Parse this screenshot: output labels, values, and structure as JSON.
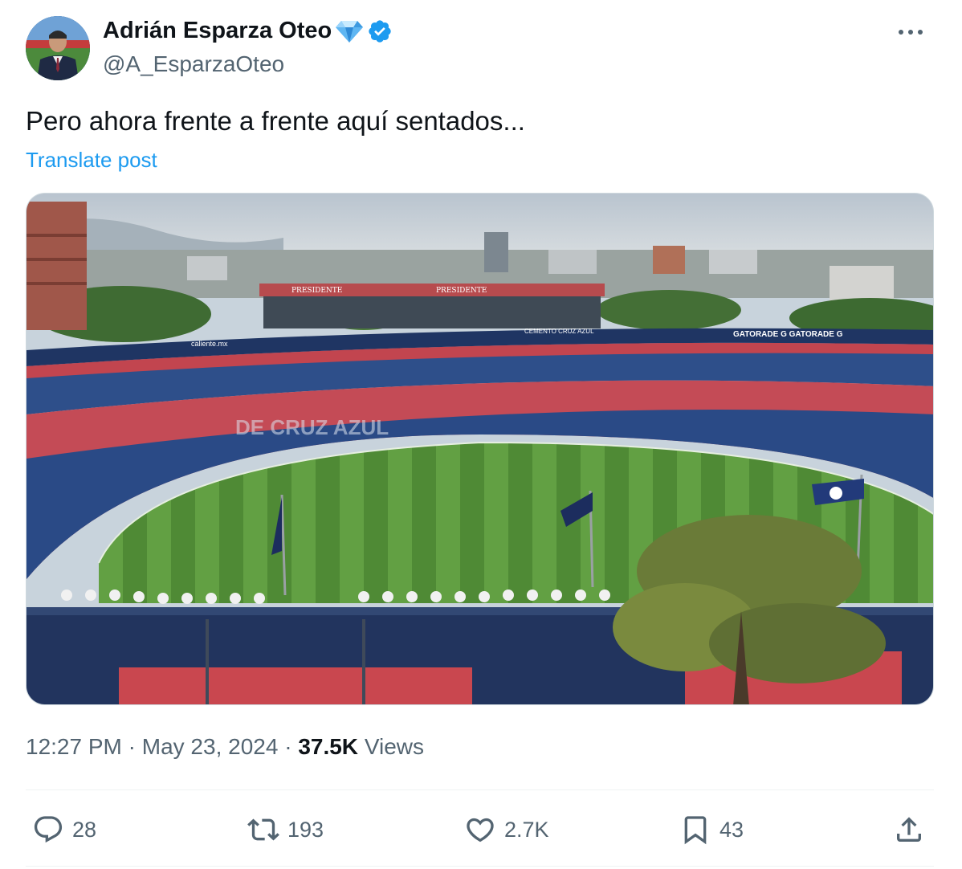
{
  "author": {
    "name": "Adrián Esparza Oteo",
    "handle": "@A_EsparzaOteo",
    "badges": [
      "diamond-emoji",
      "verified-badge"
    ],
    "verified_color": "#1d9bf0"
  },
  "tweet": {
    "text": "Pero ahora frente a frente aquí sentados...",
    "translate_label": "Translate post",
    "time": "12:27 PM",
    "separator": " · ",
    "date": "May 23, 2024",
    "views_count": "37.5K",
    "views_label": "Views"
  },
  "media": {
    "description_icon": "stadium-photo",
    "signage": {
      "gatorade": "GATORADE G GATORADE G",
      "caliente": "caliente.mx",
      "presidente": "PRESIDENTE",
      "cemento": "CEMENTO CRUZ AZUL",
      "stands_text": "DE CRUZ AZUL"
    }
  },
  "actions": {
    "replies": "28",
    "reposts": "193",
    "likes": "2.7K",
    "bookmarks": "43"
  },
  "colors": {
    "accent": "#1d9bf0",
    "secondary_text": "#536471",
    "primary_text": "#0f1419"
  }
}
